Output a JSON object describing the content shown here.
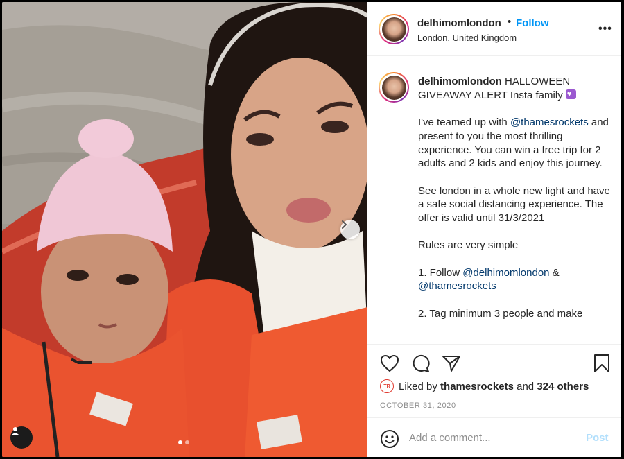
{
  "post": {
    "username": "delhimomlondon",
    "separator": "•",
    "follow_label": "Follow",
    "location": "London, United Kingdom",
    "more_label": "•••"
  },
  "caption": {
    "username": "delhimomlondon",
    "line1": "HALLOWEEN GIVEAWAY ALERT Insta family",
    "p2_a": "I've teamed up with ",
    "p2_mention": "@thamesrockets",
    "p2_b": " and present to you the most thrilling experience. You can win a free trip for 2 adults and 2 kids and enjoy this journey.",
    "p3": "See london in a whole new light and have a safe social distancing experience. The offer is valid until 31/3/2021",
    "p4": "Rules are very simple",
    "p5_a": "1. Follow ",
    "p5_mention1": "@delhimomlondon",
    "p5_b": " & ",
    "p5_mention2": "@thamesrockets",
    "p6": "2. Tag minimum 3 people and make"
  },
  "likes": {
    "prefix": "Liked by ",
    "user": "thamesrockets",
    "middle": " and ",
    "others": "324 others"
  },
  "date": "OCTOBER 31, 2020",
  "comment": {
    "placeholder": "Add a comment...",
    "post_label": "Post"
  },
  "carousel": {
    "slide_count": 2,
    "active_index": 0
  },
  "icons": {
    "like": "heart-icon",
    "comment": "comment-icon",
    "share": "paper-plane-icon",
    "save": "bookmark-icon",
    "emoji": "smiley-icon",
    "next": "chevron-right-icon",
    "tags": "user-tag-icon"
  },
  "colors": {
    "follow": "#0095f6",
    "mention": "#00376b",
    "post_disabled": "#b2dffc",
    "muted": "#8e8e8e"
  }
}
